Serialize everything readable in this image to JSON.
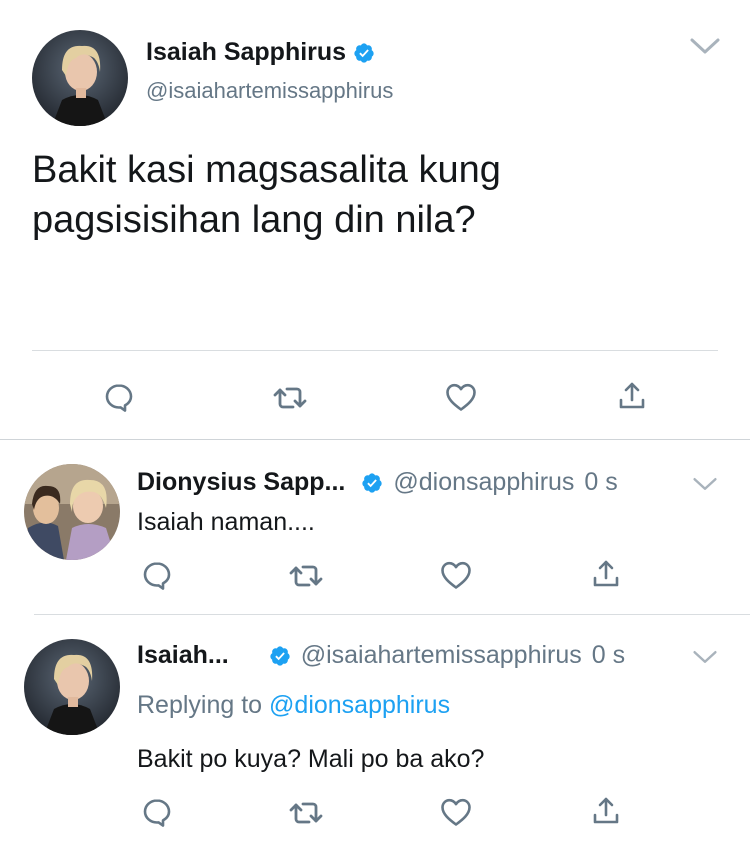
{
  "main_tweet": {
    "author_name": "Isaiah Sapphirus",
    "handle": "@isaiahartemissapphirus",
    "text_line1": "Bakit kasi magsasalita kung",
    "text_line2": "pagsisisihan lang din nila?",
    "verified": true
  },
  "replies": [
    {
      "author_name": "Dionysius Sapp...",
      "handle": "@dionsapphirus",
      "time": "0 s",
      "text": "Isaiah naman....",
      "verified": true
    },
    {
      "author_name": "Isaiah...",
      "handle": "@isaiahartemissapphirus",
      "time": "0 s",
      "replying_prefix": "Replying to",
      "replying_to": "@dionsapphirus",
      "text": "Bakit po kuya? Mali po ba ako?",
      "verified": true
    }
  ],
  "actions": [
    "reply-icon",
    "retweet-icon",
    "like-icon",
    "share-icon"
  ],
  "colors": {
    "verified": "#1da1f2",
    "link": "#1da1f2",
    "icon": "#657786",
    "secondary_text": "#657786"
  }
}
